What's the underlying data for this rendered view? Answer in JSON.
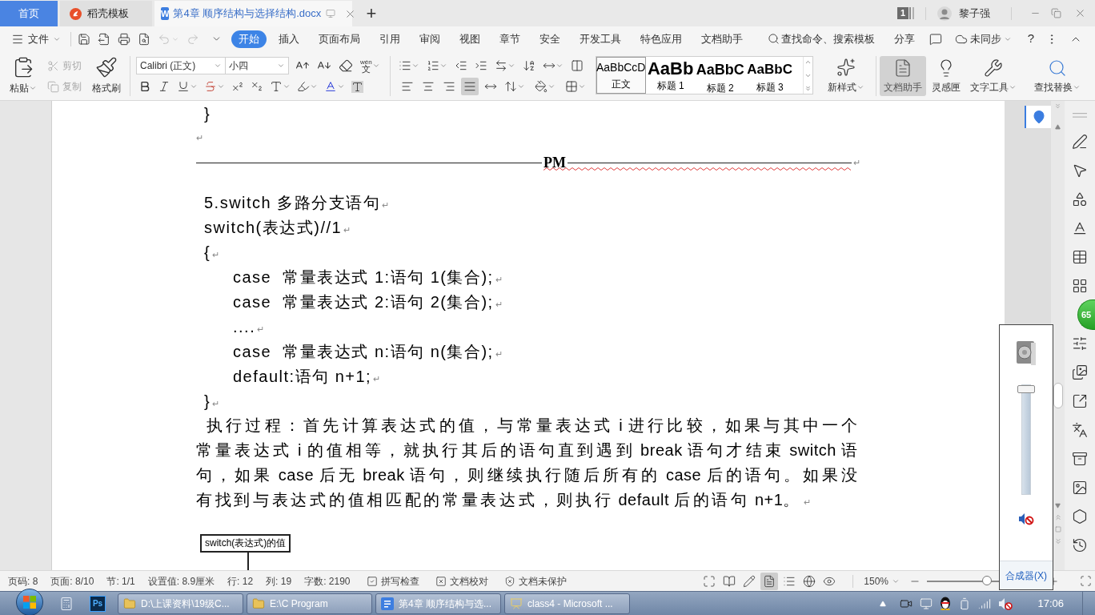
{
  "title_bar": {
    "tabs": [
      {
        "kind": "home",
        "label": "首页",
        "selected": false
      },
      {
        "kind": "template",
        "label": "稻壳模板",
        "selected": false
      },
      {
        "kind": "document",
        "logo": "W",
        "label": "第4章 顺序结构与选择结构.docx",
        "selected": true
      }
    ],
    "new_tab": "+",
    "window_count": "1",
    "user_name": "黎子强"
  },
  "menu_bar": {
    "file_menu": "文件",
    "undo_disabled": true,
    "redo_disabled": true,
    "tabs": [
      {
        "label": "开始",
        "selected": true
      },
      {
        "label": "插入",
        "selected": false
      },
      {
        "label": "页面布局",
        "selected": false
      },
      {
        "label": "引用",
        "selected": false
      },
      {
        "label": "审阅",
        "selected": false
      },
      {
        "label": "视图",
        "selected": false
      },
      {
        "label": "章节",
        "selected": false
      },
      {
        "label": "安全",
        "selected": false
      },
      {
        "label": "开发工具",
        "selected": false
      },
      {
        "label": "特色应用",
        "selected": false
      },
      {
        "label": "文档助手",
        "selected": false
      }
    ],
    "search_placeholder": "查找命令、搜索模板",
    "share": "分享",
    "sync_status": "未同步",
    "help": "?"
  },
  "ribbon": {
    "clipboard": [
      {
        "kind": "paste",
        "label": "粘贴",
        "disabled": false
      },
      {
        "kind": "cut",
        "label": "剪切",
        "disabled": true
      },
      {
        "kind": "copy",
        "label": "复制",
        "disabled": true
      },
      {
        "kind": "format_painter",
        "label": "格式刷",
        "disabled": false
      }
    ],
    "font_name": "Calibri (正文)",
    "font_size": "小四",
    "phonetic_guide": {
      "pinyin": "wén",
      "character": "文"
    },
    "alignment": [
      {
        "kind": "left",
        "selected": false
      },
      {
        "kind": "center",
        "selected": false
      },
      {
        "kind": "right",
        "selected": false
      },
      {
        "kind": "justify",
        "selected": true
      },
      {
        "kind": "distributed",
        "selected": false
      }
    ],
    "styles": [
      {
        "kind": "body",
        "preview": "AaBbCcD",
        "label": "正文",
        "selected": true
      },
      {
        "kind": "heading_1",
        "preview": "AaBb",
        "label": "标题 1",
        "selected": false
      },
      {
        "kind": "heading_2",
        "preview": "AaBbC",
        "label": "标题 2",
        "selected": false
      },
      {
        "kind": "heading_3",
        "preview": "AaBbC",
        "label": "标题 3",
        "selected": false
      }
    ],
    "new_style": "新样式",
    "tools": [
      {
        "kind": "assistant",
        "label": "文档助手",
        "selected": true
      },
      {
        "kind": "inspiration",
        "label": "灵感匣",
        "selected": false
      },
      {
        "kind": "text_tools",
        "label": "文字工具",
        "selected": false
      },
      {
        "kind": "find_replace",
        "label": "查找替换",
        "selected": false
      }
    ]
  },
  "document": {
    "lines": [
      {
        "kind": "code",
        "text": "}"
      },
      {
        "kind": "empty",
        "mark": "↵"
      },
      {
        "kind": "divider",
        "text": "PM",
        "misspelled": true,
        "mark": "↵"
      },
      {
        "kind": "code",
        "text": "5.switch 多路分支语句",
        "mark": "↵"
      },
      {
        "kind": "code",
        "text": "switch(表达式)//1",
        "mark": "↵"
      },
      {
        "kind": "code",
        "text": "{",
        "mark": "↵",
        "children": [
          {
            "kind": "code",
            "text": "case  常量表达式 1:语句 1(集合);",
            "mark": "↵"
          },
          {
            "kind": "code",
            "text": "case  常量表达式 2:语句 2(集合);",
            "mark": "↵"
          },
          {
            "kind": "code",
            "text": "....",
            "mark": "↵"
          },
          {
            "kind": "code",
            "text": "case  常量表达式 n:语句 n(集合);",
            "mark": "↵"
          },
          {
            "kind": "code",
            "text": "default:语句 n+1;",
            "mark": "↵"
          }
        ]
      },
      {
        "kind": "code",
        "text": "}",
        "mark": "↵"
      },
      {
        "kind": "paragraph",
        "text": "执行过程：首先计算表达式的值，与常量表达式 i 进行比较，如果与其中一个常量表达式 i 的值相等，就执行其后的语句直到遇到 break 语句才结束 switch 语句，如果 case 后无 break 语句，则继续执行随后所有的 case 后的语句。如果没有找到与表达式的值相匹配的常量表达式，则执行 default 后的语句 n+1。",
        "mark": "↵"
      }
    ],
    "flowchart_node": "switch(表达式)的值"
  },
  "speed_ball": "65",
  "volume_popup": {
    "level": 1,
    "muted": true,
    "mixer_link": "合成器(X)"
  },
  "status_bar": {
    "fields": [
      "页码: 8",
      "页面: 8/10",
      "节: 1/1",
      "设置值: 8.9厘米",
      "行: 12",
      "列: 19",
      "字数: 2190"
    ],
    "toggles": [
      {
        "kind": "spellcheck",
        "label": "拼写检查"
      },
      {
        "kind": "proofread",
        "label": "文档校对"
      },
      {
        "kind": "protection",
        "label": "文档未保护"
      }
    ],
    "views": [
      {
        "kind": "fullscreen",
        "selected": false
      },
      {
        "kind": "reading",
        "selected": false
      },
      {
        "kind": "writing",
        "selected": false
      },
      {
        "kind": "page",
        "selected": true
      },
      {
        "kind": "outline",
        "selected": false
      },
      {
        "kind": "web",
        "selected": false
      },
      {
        "kind": "eye_care",
        "selected": false
      }
    ],
    "zoom": {
      "value": "150%",
      "level": 0.52
    }
  },
  "taskbar": {
    "pinned": [
      {
        "kind": "calculator"
      },
      {
        "kind": "photo_editor",
        "label": "Ps"
      }
    ],
    "tasks": [
      {
        "kind": "folder",
        "label": "D:\\上课资料\\19级C..."
      },
      {
        "kind": "folder",
        "label": "E:\\C Program"
      },
      {
        "kind": "document",
        "label": "第4章 顺序结构与选..."
      },
      {
        "kind": "presentation",
        "label": "class4 - Microsoft ..."
      }
    ],
    "clock": "17:06"
  }
}
